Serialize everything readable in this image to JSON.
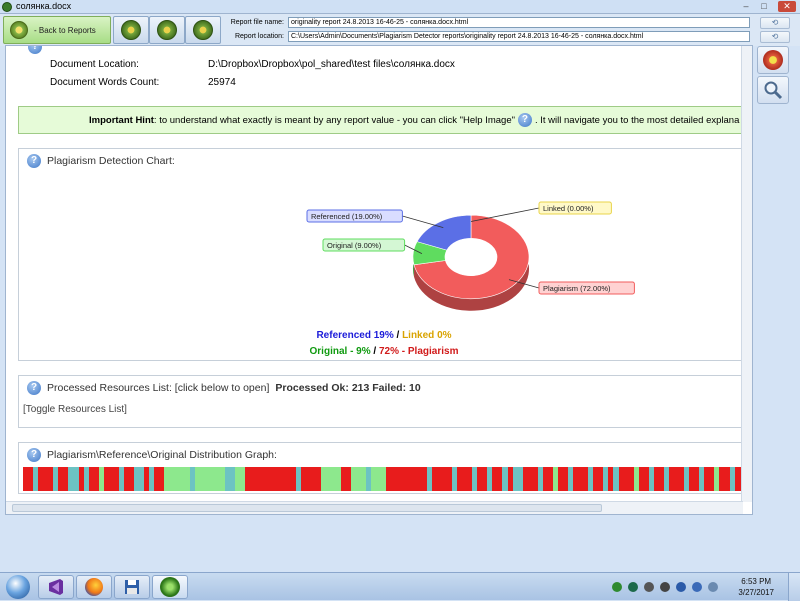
{
  "window": {
    "title": "солянка.docx"
  },
  "toolbar": {
    "back_label": "- Back to Reports",
    "report_file_label": "Report file name:",
    "report_file_value": "originality report 24.8.2013 16-46-25 - солянка.docx.html",
    "report_location_label": "Report location:",
    "report_location_value": "C:\\Users\\Admin\\Documents\\Plagiarism Detector reports\\originality report 24.8.2013 16-46-25 - солянка.docx.html"
  },
  "doc_info": {
    "location_label": "Document Location:",
    "location_value": "D:\\Dropbox\\Dropbox\\pol_shared\\test files\\солянка.docx",
    "words_label": "Document Words Count:",
    "words_value": "25974"
  },
  "hint": {
    "bold": "Important Hint",
    "text_before": ": to understand what exactly is meant by any report value - you can click \"Help Image\"",
    "text_after": ". It will navigate you to the most detailed explana"
  },
  "chart_panel": {
    "title": "Plagiarism Detection Chart:"
  },
  "chart_data": {
    "type": "pie",
    "series": [
      {
        "name": "Referenced",
        "label": "Referenced (19.00%)",
        "value": 19.0,
        "color": "#5b6fe6"
      },
      {
        "name": "Linked",
        "label": "Linked (0.00%)",
        "value": 0.0,
        "color": "#e8d44a"
      },
      {
        "name": "Plagiarism",
        "label": "Plagiarism (72.00%)",
        "value": 72.0,
        "color": "#f25c5c"
      },
      {
        "name": "Original",
        "label": "Original (9.00%)",
        "value": 9.0,
        "color": "#5fdc5f"
      }
    ],
    "summary": {
      "line1_a": "Referenced 19%",
      "line1_sep": " / ",
      "line1_b": "Linked 0%",
      "line2_a": "Original - 9%",
      "line2_sep": " / ",
      "line2_b": "72% - Plagiarism"
    }
  },
  "resources_panel": {
    "title": "Processed Resources List: [click below to open]",
    "status": "Processed Ok: 213 Failed: 10",
    "toggle": "[Toggle Resources List]"
  },
  "distribution_panel": {
    "title": "Plagiarism\\Reference\\Original Distribution Graph:",
    "segments": [
      [
        "#e81c1c",
        2
      ],
      [
        "#6cc3c3",
        1
      ],
      [
        "#e81c1c",
        3
      ],
      [
        "#6cc3c3",
        1
      ],
      [
        "#e81c1c",
        2
      ],
      [
        "#6cc3c3",
        2
      ],
      [
        "#e81c1c",
        1
      ],
      [
        "#6cc3c3",
        1
      ],
      [
        "#e81c1c",
        2
      ],
      [
        "#8de88d",
        1
      ],
      [
        "#e81c1c",
        3
      ],
      [
        "#6cc3c3",
        1
      ],
      [
        "#e81c1c",
        2
      ],
      [
        "#6cc3c3",
        2
      ],
      [
        "#e81c1c",
        1
      ],
      [
        "#6cc3c3",
        1
      ],
      [
        "#e81c1c",
        2
      ],
      [
        "#8de88d",
        5
      ],
      [
        "#6cc3c3",
        1
      ],
      [
        "#8de88d",
        6
      ],
      [
        "#6cc3c3",
        2
      ],
      [
        "#8de88d",
        2
      ],
      [
        "#e81c1c",
        4
      ],
      [
        "#e81c1c",
        6
      ],
      [
        "#6cc3c3",
        1
      ],
      [
        "#e81c1c",
        4
      ],
      [
        "#8de88d",
        4
      ],
      [
        "#e81c1c",
        2
      ],
      [
        "#8de88d",
        3
      ],
      [
        "#6cc3c3",
        1
      ],
      [
        "#8de88d",
        3
      ],
      [
        "#e81c1c",
        5
      ],
      [
        "#e81c1c",
        3
      ],
      [
        "#6cc3c3",
        1
      ],
      [
        "#e81c1c",
        4
      ],
      [
        "#6cc3c3",
        1
      ],
      [
        "#e81c1c",
        3
      ],
      [
        "#6cc3c3",
        1
      ],
      [
        "#e81c1c",
        2
      ],
      [
        "#6cc3c3",
        1
      ],
      [
        "#e81c1c",
        2
      ],
      [
        "#6cc3c3",
        1
      ],
      [
        "#e81c1c",
        1
      ],
      [
        "#6cc3c3",
        2
      ],
      [
        "#e81c1c",
        3
      ],
      [
        "#6cc3c3",
        1
      ],
      [
        "#e81c1c",
        2
      ],
      [
        "#8de88d",
        1
      ],
      [
        "#e81c1c",
        2
      ],
      [
        "#6cc3c3",
        1
      ],
      [
        "#e81c1c",
        3
      ],
      [
        "#6cc3c3",
        1
      ],
      [
        "#e81c1c",
        2
      ],
      [
        "#6cc3c3",
        1
      ],
      [
        "#e81c1c",
        1
      ],
      [
        "#6cc3c3",
        1
      ],
      [
        "#e81c1c",
        3
      ],
      [
        "#8de88d",
        1
      ],
      [
        "#e81c1c",
        2
      ],
      [
        "#6cc3c3",
        1
      ],
      [
        "#e81c1c",
        2
      ],
      [
        "#6cc3c3",
        1
      ],
      [
        "#e81c1c",
        3
      ],
      [
        "#6cc3c3",
        1
      ],
      [
        "#e81c1c",
        2
      ],
      [
        "#6cc3c3",
        1
      ],
      [
        "#e81c1c",
        2
      ],
      [
        "#8de88d",
        1
      ],
      [
        "#e81c1c",
        2
      ],
      [
        "#6cc3c3",
        1
      ],
      [
        "#e81c1c",
        2
      ]
    ]
  },
  "taskbar": {
    "time": "6:53 PM",
    "date": "3/27/2017"
  }
}
